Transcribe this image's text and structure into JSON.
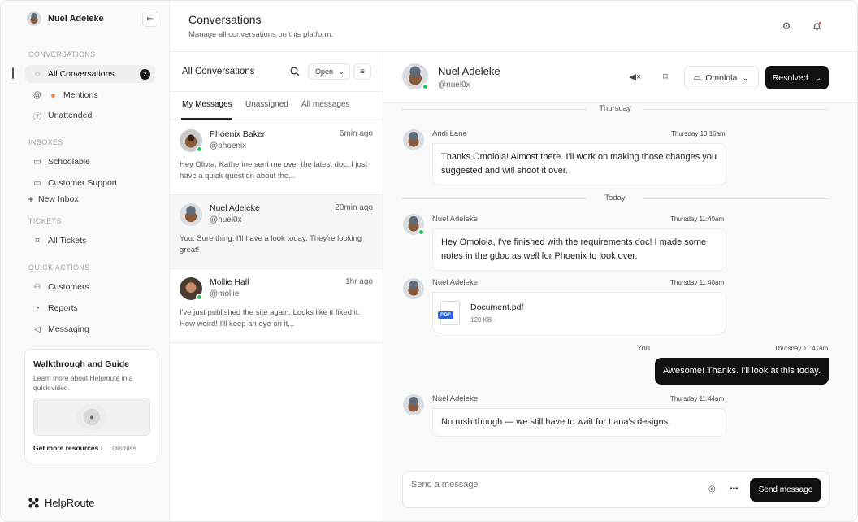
{
  "sidebar": {
    "user_name": "Nuel Adeleke",
    "sections": {
      "conversations": "CONVERSATIONS",
      "inboxes": "INBOXES",
      "tickets": "TICKETS",
      "quick_actions": "QUICK ACTIONS"
    },
    "items": {
      "all_conversations": "All Conversations",
      "all_conversations_count": "2",
      "mentions": "Mentions",
      "unattended": "Unattended",
      "schoolable": "Schoolable",
      "customer_support": "Customer Support",
      "new_inbox": "New Inbox",
      "all_tickets": "All Tickets",
      "customers": "Customers",
      "reports": "Reports",
      "messaging": "Messaging"
    },
    "guide": {
      "title": "Walkthrough and Guide",
      "description": "Learn more about Helproute in a quick video.",
      "more": "Get more resources",
      "dismiss": "Dismiss"
    },
    "logo": "HelpRoute"
  },
  "header": {
    "title": "Conversations",
    "subtitle": "Manage all conversations on this platform."
  },
  "list": {
    "title": "All Conversations",
    "filter_value": "Open",
    "tabs": [
      "My Messages",
      "Unassigned",
      "All messages"
    ],
    "conversations": [
      {
        "name": "Phoenix Baker",
        "handle": "@phoenix",
        "time": "5min ago",
        "preview": "Hey Olivia, Katherine sent me over the latest doc. I just have a quick question about the..."
      },
      {
        "name": "Nuel Adeleke",
        "handle": "@nuel0x",
        "time": "20min ago",
        "preview": "You: Sure thing, I'll have a look today. They're looking great!"
      },
      {
        "name": "Mollie Hall",
        "handle": "@mollie",
        "time": "1hr ago",
        "preview": "I've just published the site again. Looks like it fixed it. How weird! I'll keep an eye on it..."
      }
    ]
  },
  "chat": {
    "name": "Nuel Adeleke",
    "handle": "@nuel0x",
    "agent": "Omolola",
    "status": "Resolved",
    "days": [
      "Thursday",
      "Today"
    ],
    "messages": [
      {
        "sender": "Andi Lane",
        "time": "Thursday 10:16am",
        "text": "Thanks Omolola! Almost there. I'll work on making those changes you suggested and will shoot it over."
      },
      {
        "sender": "Nuel Adeleke",
        "time": "Thursday 11:40am",
        "text": "Hey Omolola, I've finished with the requirements doc! I made some notes in the gdoc as well for Phoenix to look over."
      },
      {
        "sender": "Nuel Adeleke",
        "time": "Thursday 11:40am",
        "file_name": "Document.pdf",
        "file_size": "120 KB ·",
        "file_type": "PDF"
      },
      {
        "sender": "You",
        "time": "Thursday 11:41am",
        "text": "Awesome! Thanks. I'll look at this today."
      },
      {
        "sender": "Nuel Adeleke",
        "time": "Thursday 11:44am",
        "text": "No rush though — we still have to wait for Lana's designs."
      }
    ],
    "composer_placeholder": "Send a message",
    "send_label": "Send message"
  },
  "colors": {
    "online": "#22c55e",
    "mention_dot": "#f0884a",
    "primary": "#111111",
    "pdf": "#2563eb"
  }
}
